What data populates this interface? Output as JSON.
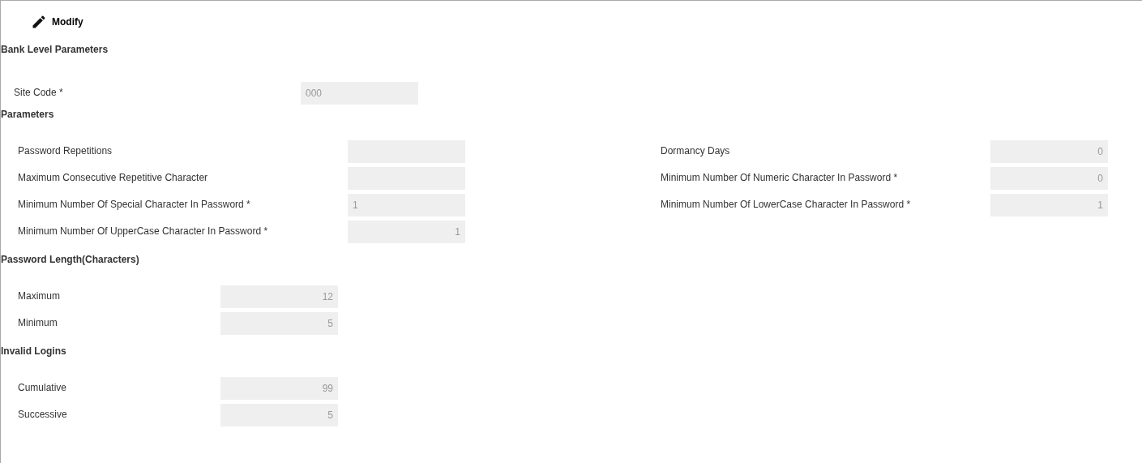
{
  "toolbar": {
    "modify_button": "Modify"
  },
  "bank_level": {
    "title": "Bank Level Parameters",
    "site_code": {
      "label": "Site Code *",
      "value": "000",
      "kind": "start"
    }
  },
  "parameters": {
    "title": "Parameters",
    "left": [
      {
        "label": "Password Repetitions",
        "kind": "end"
      },
      {
        "label": "Maximum Consecutive Repetitive Character",
        "kind": "end"
      },
      {
        "label": "Minimum Number Of Special Character In Password *",
        "value": "1",
        "kind": "start"
      },
      {
        "label": "Minimum Number Of UpperCase Character In Password *",
        "value": "1",
        "kind": "end"
      }
    ],
    "right": [
      {
        "label": "Dormancy Days",
        "value": "0",
        "kind": "end"
      },
      {
        "label": "Minimum Number Of Numeric Character In Password *",
        "value": "0",
        "kind": "end"
      },
      {
        "label": "Minimum Number Of LowerCase Character In Password *",
        "value": "1",
        "kind": "end"
      }
    ]
  },
  "password_length": {
    "title": "Password Length(Characters)",
    "fields": [
      {
        "label": "Maximum",
        "value": "12",
        "kind": "end"
      },
      {
        "label": "Minimum",
        "value": "5",
        "kind": "end"
      }
    ]
  },
  "invalid_logins": {
    "title": "Invalid Logins",
    "fields": [
      {
        "label": "Cumulative",
        "value": "99",
        "kind": "end"
      },
      {
        "label": "Successive",
        "value": "5",
        "kind": "end"
      }
    ]
  }
}
